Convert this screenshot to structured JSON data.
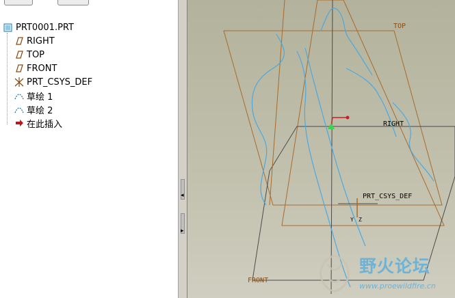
{
  "model_tree": {
    "root": "PRT0001.PRT",
    "items": [
      {
        "label": "RIGHT",
        "icon": "datum-plane-icon"
      },
      {
        "label": "TOP",
        "icon": "datum-plane-icon"
      },
      {
        "label": "FRONT",
        "icon": "datum-plane-icon"
      },
      {
        "label": "PRT_CSYS_DEF",
        "icon": "coordinate-system-icon"
      },
      {
        "label": "草绘 1",
        "icon": "sketch-icon"
      },
      {
        "label": "草绘 2",
        "icon": "sketch-icon"
      },
      {
        "label": "在此插入",
        "icon": "insert-here-arrow-icon"
      }
    ]
  },
  "viewport": {
    "labels": {
      "top": "TOP",
      "right": "RIGHT",
      "front": "FRONT",
      "csys": "PRT_CSYS_DEF",
      "axis_y": "Y",
      "axis_z": "Z"
    },
    "colors": {
      "plane": "#a86a2a",
      "front_plane": "#4a4a4a",
      "curve": "#4aa8e0"
    }
  },
  "watermark": {
    "title": "野火论坛",
    "url": "www.proewildfire.cn"
  }
}
